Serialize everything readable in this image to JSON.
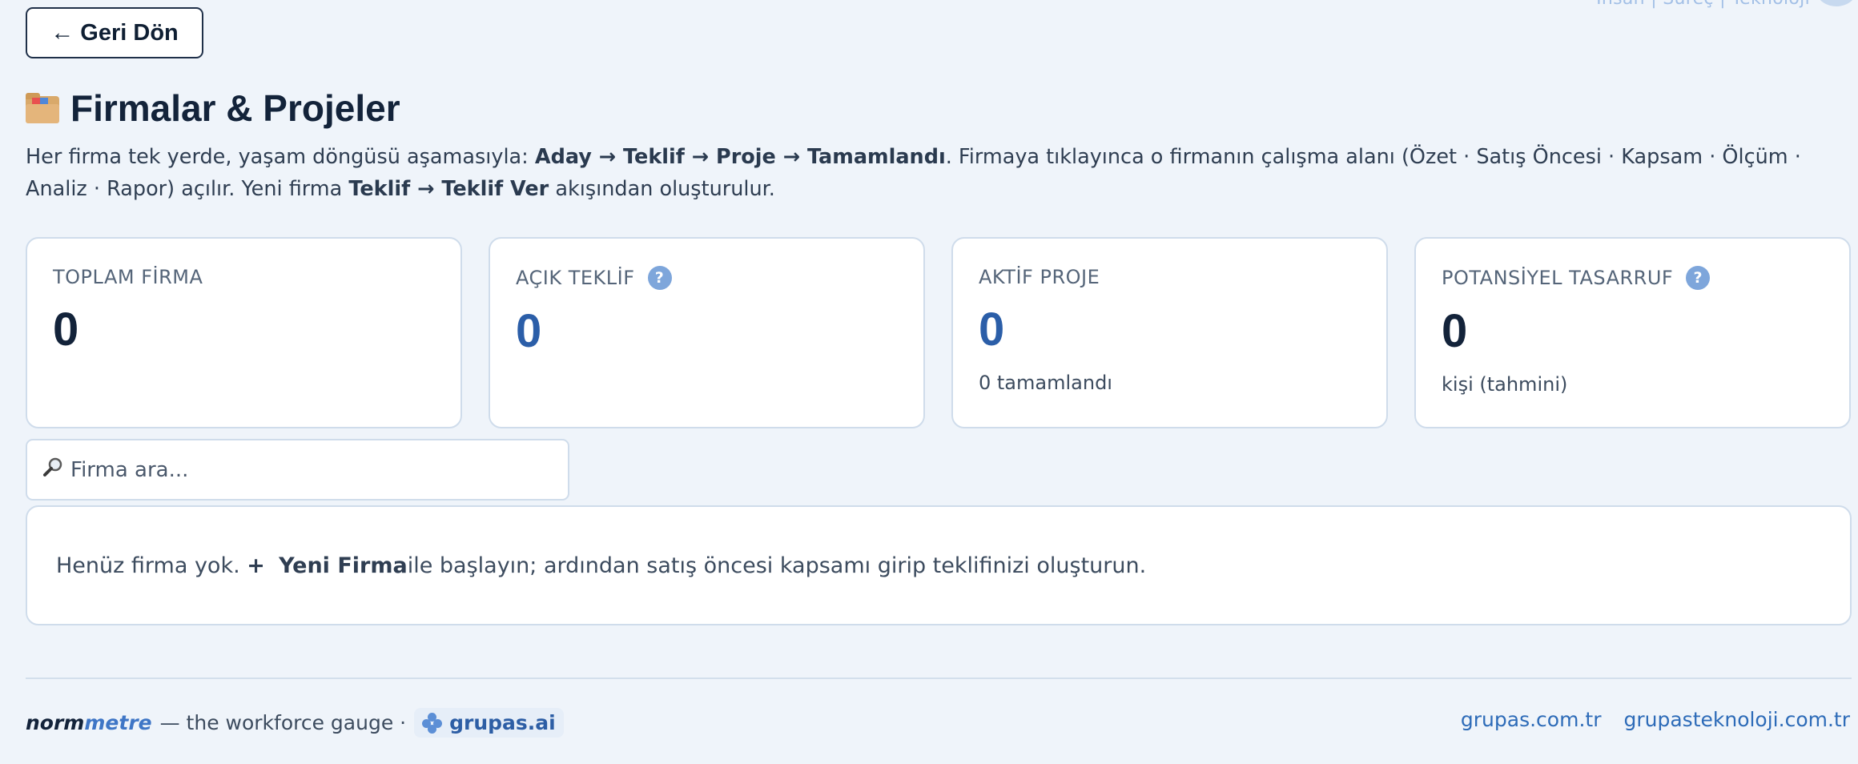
{
  "header": {
    "back_label": "← Geri Dön",
    "brand_partial": "İnsan | Süreç | Teknoloji"
  },
  "page": {
    "title": "Firmalar & Projeler",
    "description": {
      "intro": "Her firma tek yerde, yaşam döngüsü aşamasıyla: ",
      "stages": "Aday → Teklif → Proje → Tamamlandı",
      "middle": ". Firmaya tıklayınca o firmanın çalışma alanı (Özet · Satış Öncesi · Kapsam · Ölçüm · Analiz · Rapor) açılır. Yeni firma ",
      "flow": "Teklif → Teklif Ver",
      "end": " akışından oluşturulur."
    }
  },
  "stats": [
    {
      "label": "TOPLAM FİRMA",
      "value": "0",
      "sub": "",
      "help": false,
      "value_color": "#13233a"
    },
    {
      "label": "AÇIK TEKLİF",
      "value": "0",
      "sub": "",
      "help": true,
      "value_color": "#2b5ea8"
    },
    {
      "label": "AKTİF PROJE",
      "value": "0",
      "sub": "0 tamamlandı",
      "help": false,
      "value_color": "#2b5ea8"
    },
    {
      "label": "POTANSİYEL TASARRUF",
      "value": "0",
      "sub": "kişi (tahmini)",
      "help": true,
      "value_color": "#13233a"
    }
  ],
  "help_glyph": "?",
  "search": {
    "placeholder": "Firma ara...",
    "icon": "magnifier-icon"
  },
  "empty": {
    "pre": "Henüz firma yok. ",
    "plus": "+",
    "cta": "Yeni Firma",
    "post": " ile başlayın; ardından satış öncesi kapsamı girip teklifinizi oluşturun."
  },
  "footer": {
    "brand_norm": "norm",
    "brand_metre": "metre",
    "tagline": "— the workforce gauge ·",
    "grupas_ai": "grupas.ai",
    "links": [
      "grupas.com.tr",
      "grupasteknoloji.com.tr"
    ]
  },
  "colors": {
    "accent": "#2b5ea8",
    "background": "#eff4fa",
    "border": "#cfdceb"
  }
}
